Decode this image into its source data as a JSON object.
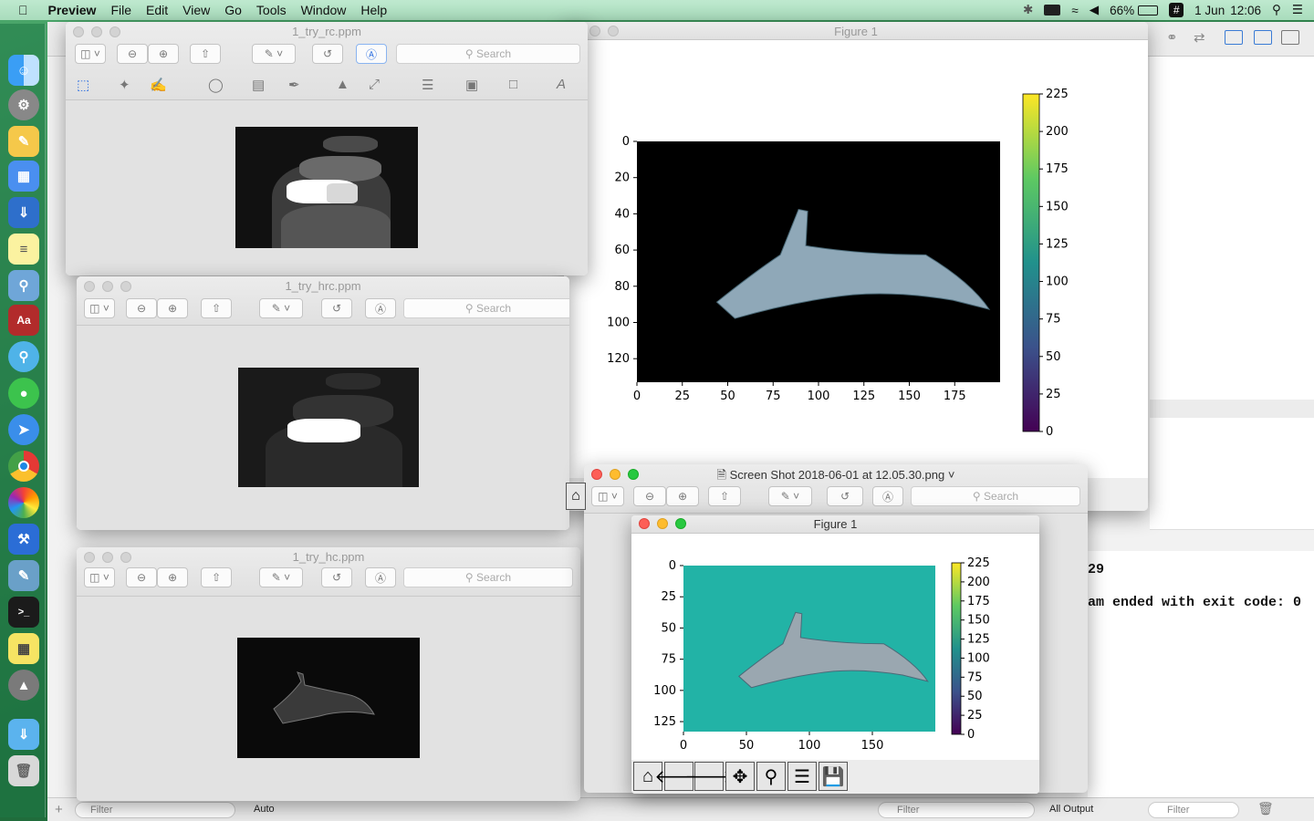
{
  "menubar": {
    "app": "Preview",
    "items": [
      "File",
      "Edit",
      "View",
      "Go",
      "Tools",
      "Window",
      "Help"
    ],
    "battery": "66%",
    "date": "1 Jun",
    "time": "12:06"
  },
  "ide": {
    "console_line1": "29",
    "console_line2": "am ended with exit code: 0",
    "filter_left": "Filter",
    "auto_label": "Auto",
    "filter_mid": "Filter",
    "all_output": "All Output",
    "filter_right": "Filter"
  },
  "win_rc": {
    "title": "1_try_rc.ppm",
    "search": "Search"
  },
  "win_hrc": {
    "title": "1_try_hrc.ppm",
    "search": "Search"
  },
  "win_hc": {
    "title": "1_try_hc.ppm",
    "search": "Search"
  },
  "win_fig_big": {
    "title": "Figure 1"
  },
  "win_screenshot": {
    "title": "Screen Shot 2018-06-01 at 12.05.30.png",
    "search": "Search"
  },
  "win_fig_small": {
    "title": "Figure 1"
  },
  "chart_data": [
    {
      "type": "heatmap",
      "title": "",
      "y_ticks": [
        "0",
        "20",
        "40",
        "60",
        "80",
        "100",
        "120"
      ],
      "x_ticks": [
        "0",
        "25",
        "50",
        "75",
        "100",
        "125",
        "150",
        "175"
      ],
      "colorbar_ticks": [
        "0",
        "25",
        "50",
        "75",
        "100",
        "125",
        "150",
        "175",
        "200",
        "225"
      ],
      "colormap": "viridis",
      "colorbar_range": [
        0,
        225
      ],
      "xlim": [
        0,
        200
      ],
      "ylim": [
        133,
        0
      ]
    },
    {
      "type": "heatmap",
      "title": "",
      "y_ticks": [
        "0",
        "25",
        "50",
        "75",
        "100",
        "125"
      ],
      "x_ticks": [
        "0",
        "50",
        "100",
        "150"
      ],
      "colorbar_ticks": [
        "0",
        "25",
        "50",
        "75",
        "100",
        "125",
        "150",
        "175",
        "200",
        "225"
      ],
      "colormap": "viridis",
      "colorbar_range": [
        0,
        225
      ],
      "xlim": [
        0,
        200
      ],
      "ylim": [
        133,
        0
      ]
    }
  ]
}
